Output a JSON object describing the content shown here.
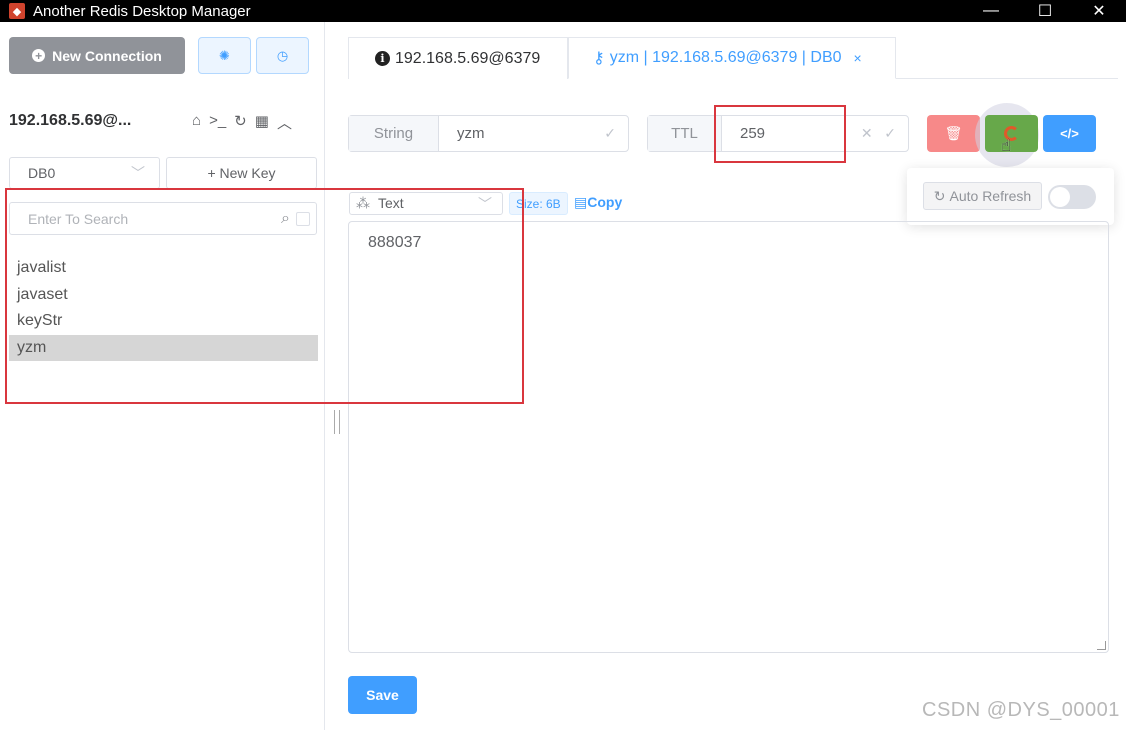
{
  "window": {
    "title": "Another Redis Desktop Manager",
    "minimize": "—",
    "maximize": "☐",
    "close": "✕"
  },
  "sidebar": {
    "new_connection_label": "New Connection",
    "connection_name": "192.168.5.69@...",
    "db_selected": "DB0",
    "new_key_label": "+ New Key",
    "search_placeholder": "Enter To Search",
    "keys": [
      "javalist",
      "javaset",
      "keyStr",
      "yzm"
    ],
    "active_key": "yzm"
  },
  "tabs": [
    {
      "label": "192.168.5.69@6379"
    },
    {
      "label": "yzm | 192.168.5.69@6379 | DB0",
      "close": "×"
    }
  ],
  "key_detail": {
    "type_prefix": "String",
    "key_name": "yzm",
    "ttl_prefix": "TTL",
    "ttl_value": "259",
    "format": "Text",
    "size": "Size: 6B",
    "copy_label": "Copy",
    "value": "888037",
    "save_label": "Save"
  },
  "auto_refresh": {
    "label": "Auto Refresh",
    "enabled": false
  },
  "watermark": "CSDN @DYS_00001",
  "colors": {
    "primary": "#409eff",
    "danger": "#f78989",
    "success": "#67a84a",
    "highlight": "#d9363e"
  }
}
